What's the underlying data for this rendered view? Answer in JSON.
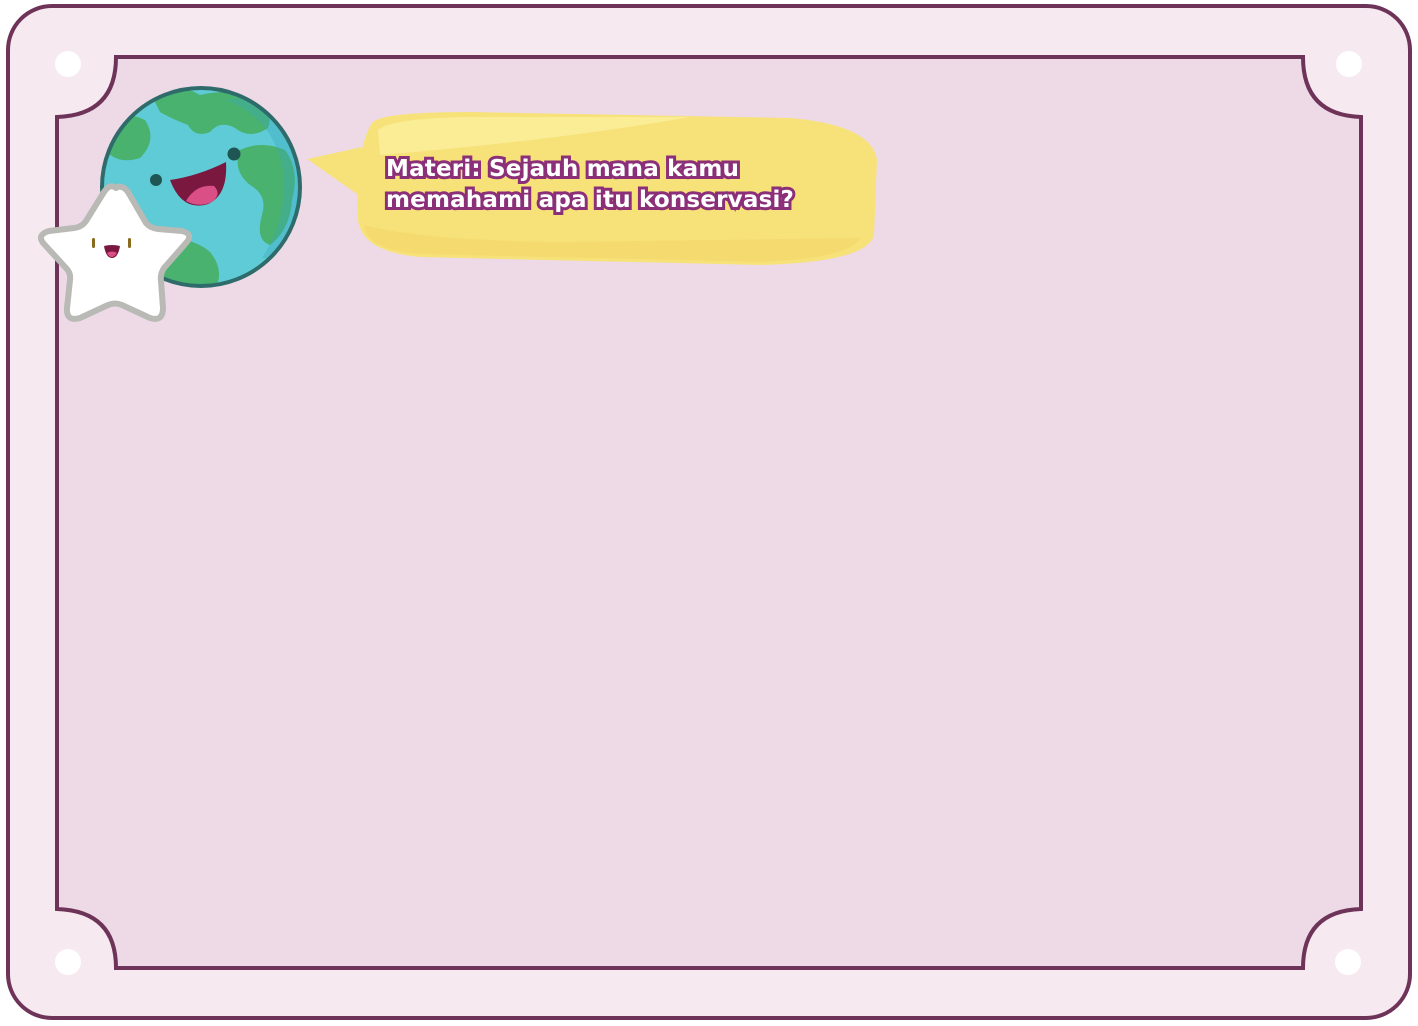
{
  "speech_bubble": {
    "line1": "Materi: Sejauh mana kamu",
    "line2": "memahami apa itu konservasi?"
  },
  "colors": {
    "outer_board": "#f6e9f0",
    "inner_board": "#eddae6",
    "frame_border": "#6e3358",
    "corner_dots": "#ffffff",
    "bubble_fill": "#f7e27a",
    "bubble_text": "#ffffff",
    "bubble_text_outline": "#8a2f78",
    "earth_ocean": "#5fcbd6",
    "earth_land": "#49b26e",
    "earth_outline": "#2e6b6a",
    "star_fill": "#ffffff",
    "star_outline": "#b9b9b5"
  },
  "icons": {
    "earth": "earth-mascot-icon",
    "star": "star-mascot-icon"
  }
}
